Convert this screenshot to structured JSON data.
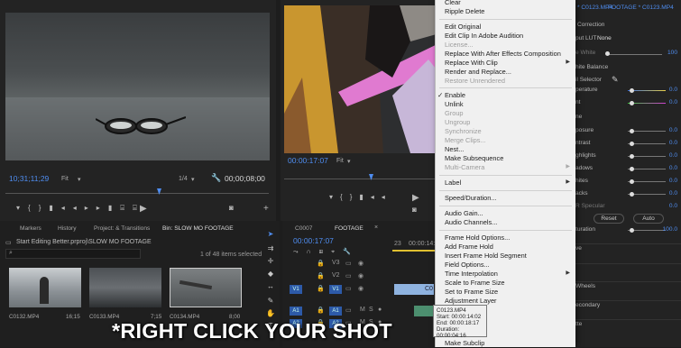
{
  "source_monitor": {
    "timecode": "10;31;11;29",
    "fit": "Fit",
    "resolution": "1/4",
    "duration": "00;00;08;00"
  },
  "program_monitor": {
    "timecode": "00:00:17:07",
    "fit": "Fit"
  },
  "context_menu": {
    "items": [
      {
        "label": "Clear",
        "disabled": false
      },
      {
        "label": "Ripple Delete",
        "disabled": false
      },
      {
        "label": "Edit Original",
        "disabled": false
      },
      {
        "label": "Edit Clip In Adobe Audition",
        "disabled": false
      },
      {
        "label": "License...",
        "disabled": true
      },
      {
        "label": "Replace With After Effects Composition",
        "disabled": false
      },
      {
        "label": "Replace With Clip",
        "disabled": false,
        "submenu": true
      },
      {
        "label": "Render and Replace...",
        "disabled": false
      },
      {
        "label": "Restore Unrendered",
        "disabled": true
      },
      {
        "label": "Enable",
        "disabled": false,
        "checked": true
      },
      {
        "label": "Unlink",
        "disabled": false
      },
      {
        "label": "Group",
        "disabled": true
      },
      {
        "label": "Ungroup",
        "disabled": true
      },
      {
        "label": "Synchronize",
        "disabled": true
      },
      {
        "label": "Merge Clips...",
        "disabled": true
      },
      {
        "label": "Nest...",
        "disabled": false
      },
      {
        "label": "Make Subsequence",
        "disabled": false
      },
      {
        "label": "Multi-Camera",
        "disabled": true,
        "submenu": true
      },
      {
        "label": "Label",
        "disabled": false,
        "submenu": true
      },
      {
        "label": "Speed/Duration...",
        "disabled": false
      },
      {
        "label": "Audio Gain...",
        "disabled": false
      },
      {
        "label": "Audio Channels...",
        "disabled": false
      },
      {
        "label": "Frame Hold Options...",
        "disabled": false
      },
      {
        "label": "Add Frame Hold",
        "disabled": false
      },
      {
        "label": "Insert Frame Hold Segment",
        "disabled": false
      },
      {
        "label": "Field Options...",
        "disabled": false
      },
      {
        "label": "Time Interpolation",
        "disabled": false,
        "submenu": true
      },
      {
        "label": "Scale to Frame Size",
        "disabled": false
      },
      {
        "label": "Set to Frame Size",
        "disabled": false
      },
      {
        "label": "Adjustment Layer",
        "disabled": false
      },
      {
        "label": "Make Subclip",
        "disabled": false
      }
    ],
    "checkmark": "✓"
  },
  "lumetri": {
    "tab": "FOOTAGE * C0123.MP4",
    "prefix": "* C0123.MP4",
    "input_lut_label": "put LUT",
    "input_lut_value": "None",
    "correction": "Correction",
    "white_label": "e White",
    "white_val": "100",
    "wb": "hite Balance",
    "wbsel": "il Selector",
    "temperature": "perature",
    "temperature_val": "0.0",
    "tint": "nt",
    "tint_val": "0.0",
    "tone": "ne",
    "exposure": "posure",
    "exposure_val": "0.0",
    "contrast": "ntrast",
    "contrast_val": "0.0",
    "highlights": "ghlights",
    "highlights_val": "0.0",
    "shadows": "adows",
    "shadows_val": "0.0",
    "whites": "hites",
    "whites_val": "0.0",
    "blacks": "acks",
    "blacks_val": "0.0",
    "specular": "R Specular",
    "specular_val": "0.0",
    "reset": "Reset",
    "auto": "Auto",
    "saturation": "turation",
    "saturation_val": "100.0",
    "ve": "ve",
    "wheels": "Wheels",
    "secondary": "econdary",
    "tte": "tte"
  },
  "project_panel": {
    "tabs": [
      "Markers",
      "History",
      "Project: & Transitions",
      "Bin: SLOW MO FOOTAGE"
    ],
    "path": "Start Editing Better.prproj\\SLOW MO FOOTAGE",
    "items_selected": "1 of 48 items selected",
    "clips": [
      {
        "name": "C0132.MP4",
        "duration": "16;15"
      },
      {
        "name": "C0133.MP4",
        "duration": "7;15"
      },
      {
        "name": "C0134.MP4",
        "duration": "8;00"
      }
    ]
  },
  "timeline": {
    "tabs": [
      "C0007",
      "FOOTAGE"
    ],
    "timecode": "00:00:17:07",
    "ruler": [
      "23",
      "00:00:14:23"
    ],
    "tracks": [
      "V3",
      "V2",
      "V1",
      "A1",
      "A2"
    ],
    "clip_label": "C0",
    "mute": "M",
    "solo": "S"
  },
  "tooltip": {
    "name": "C0123.MP4",
    "start": "Start: 00:00:14:02",
    "end": "End: 00:00:18:17",
    "duration": "Duration: 00:00:04:16"
  },
  "caption": "*RIGHT CLICK YOUR SHOT"
}
